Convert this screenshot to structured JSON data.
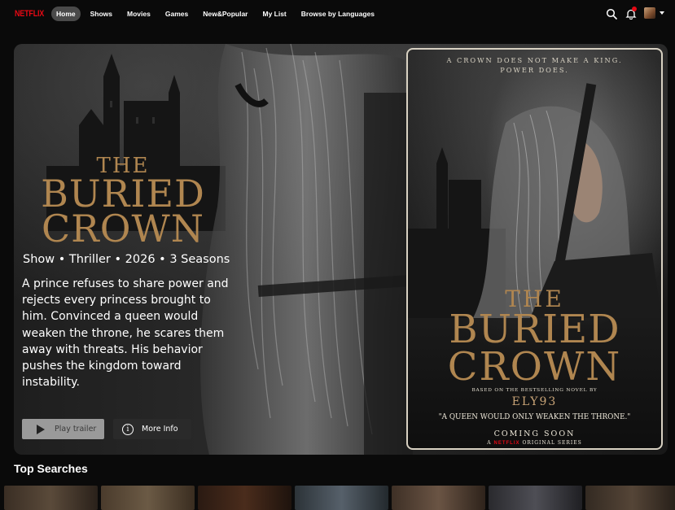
{
  "nav": {
    "logo": "NETFLIX",
    "items": [
      {
        "label": "Home",
        "active": true
      },
      {
        "label": "Shows",
        "active": false
      },
      {
        "label": "Movies",
        "active": false
      },
      {
        "label": "Games",
        "active": false
      },
      {
        "label": "New&Popular",
        "active": false
      },
      {
        "label": "My List",
        "active": false
      },
      {
        "label": "Browse by Languages",
        "active": false
      }
    ],
    "icons": [
      "search-icon",
      "bell-icon",
      "avatar",
      "caret-down-icon"
    ]
  },
  "hero": {
    "title_line1": "THE",
    "title_line2": "BURIED",
    "title_line3": "CROWN",
    "meta": "Show • Thriller • 2026 • 3 Seasons",
    "description": "A prince refuses to share power and rejects every princess brought to him. Convinced a queen would weaken the throne, he scares them away with threats. His behavior pushes the kingdom toward instability.",
    "play_label": "Play trailer",
    "info_label": "More Info",
    "info_glyph": "i"
  },
  "poster": {
    "tagline_line1": "A CROWN DOES NOT MAKE A KING.",
    "tagline_line2": "POWER DOES.",
    "title_line1": "THE",
    "title_line2": "BURIED",
    "title_line3": "CROWN",
    "based_on": "BASED ON THE BESTSELLING NOVEL BY",
    "author": "ELY93",
    "quote": "\"A QUEEN WOULD ONLY WEAKEN THE THRONE.\"",
    "coming": "COMING SOON",
    "series_prefix": "A",
    "series_brand": "NETFLIX",
    "series_suffix": "ORIGINAL SERIES"
  },
  "top_searches": {
    "title": "Top Searches"
  },
  "colors": {
    "brand": "#e50914",
    "title_gold": "#b08650",
    "background": "#0a0a0a"
  }
}
